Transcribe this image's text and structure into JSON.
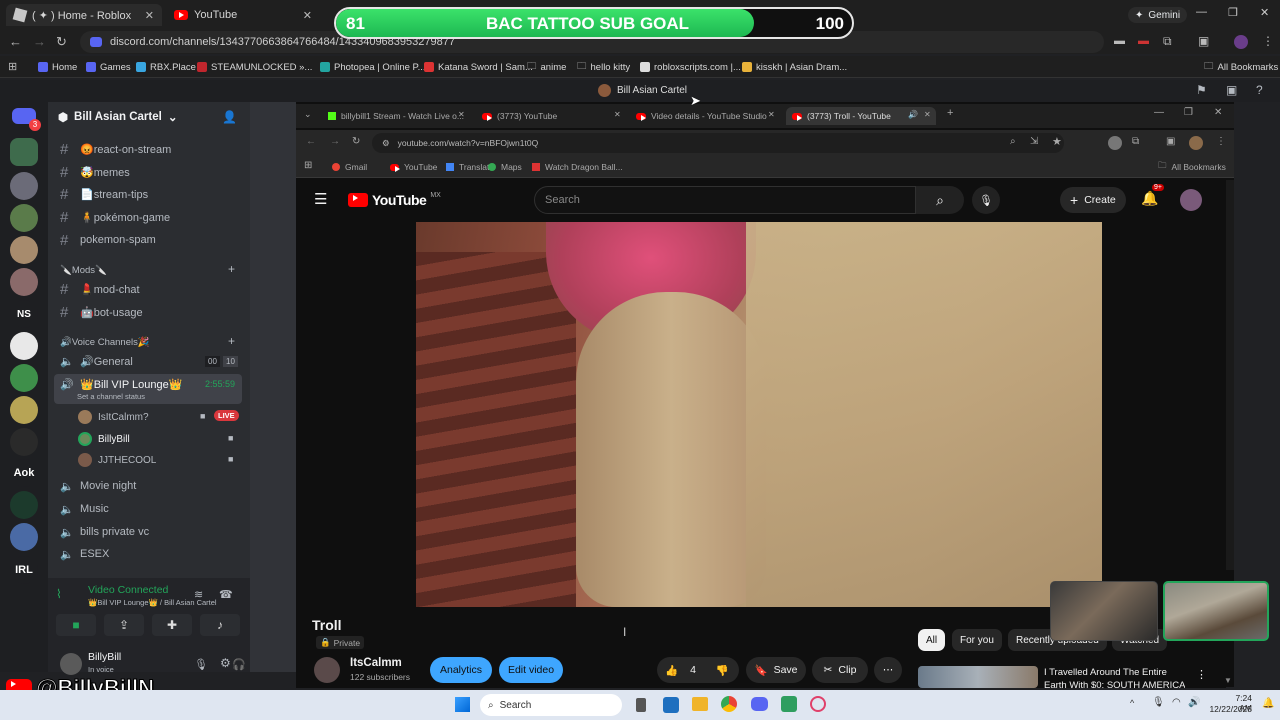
{
  "outer_tabs": [
    {
      "label": "( ✦ ) Home - Roblox"
    },
    {
      "label": "YouTube"
    }
  ],
  "outer_url": "discord.com/channels/1343770663864766484/1433409683953279877",
  "gemini_label": "Gemini",
  "bookmarks": [
    "Home",
    "Games",
    "RBX.Place",
    "STEAMUNLOCKED »...",
    "Photopea | Online P...",
    "Katana Sword | Sam...",
    "anime",
    "hello kitty",
    "robloxscripts.com |...",
    "kisskh | Asian Dram...",
    "All Bookmarks"
  ],
  "goal": {
    "start": "81",
    "title": "BAC TATTOO SUB GOAL",
    "end": "100",
    "progress": 0.81
  },
  "discord": {
    "window_title": "Bill Asian Cartel",
    "server_name": "Bill Asian Cartel",
    "server_notification": "3",
    "text_channels": [
      "😡react-on-stream",
      "🤯memes",
      "📄stream-tips",
      "🧍pokémon-game",
      "pokemon-spam"
    ],
    "mods_category": "🔪Mods🔪",
    "mods_channels": [
      "💄mod-chat",
      "🤖bot-usage"
    ],
    "voice_category": "🔊Voice Channels🎉",
    "general_label": "🔊General",
    "general_count_a": "00",
    "general_count_b": "10",
    "vip_label": "👑Bill VIP Lounge👑",
    "vip_time": "2:55:59",
    "vip_status": "Set a channel status",
    "vip_users": [
      "IsItCalmm?",
      "BillyBill",
      "JJTHECOOL"
    ],
    "live_badge": "LIVE",
    "other_voice": [
      "Movie night",
      "Music",
      "bills private vc",
      "ESEX"
    ],
    "server_labels": [
      "NS",
      "Aok",
      "IRL"
    ],
    "connected_title": "Video Connected",
    "connected_sub": "👑Bill VIP Lounge👑 / Bill Asian Cartel",
    "user_name": "BillyBill",
    "user_status": "In voice"
  },
  "handle_overlay": "@BillyBillN",
  "inner_browser": {
    "tabs": [
      "billybill1 Stream - Watch Live o...",
      "(3773) YouTube",
      "Video details - YouTube Studio",
      "(3773) Troll - YouTube"
    ],
    "url": "youtube.com/watch?v=nBFOjwn1t0Q",
    "bookmarks": [
      "Gmail",
      "YouTube",
      "Translate",
      "Maps",
      "Watch Dragon Ball...",
      "All Bookmarks"
    ]
  },
  "youtube": {
    "logo_text": "YouTube",
    "country_code": "MX",
    "search_placeholder": "Search",
    "create_label": "Create",
    "notif_count": "9+",
    "video_title": "Troll",
    "privacy": "Private",
    "channel_name": "ItsCalmm",
    "subscribers": "122 subscribers",
    "analytics_label": "Analytics",
    "edit_label": "Edit video",
    "likes": "4",
    "save_label": "Save",
    "clip_label": "Clip",
    "chips": [
      "All",
      "For you",
      "Recently uploaded",
      "Watched"
    ],
    "rec_title_1": "I Travelled Around The Entire",
    "rec_title_2": "Earth With $0: SOUTH AMERICA"
  },
  "taskbar": {
    "search_label": "Search",
    "time": "7:24 AM",
    "date": "12/22/2025"
  }
}
